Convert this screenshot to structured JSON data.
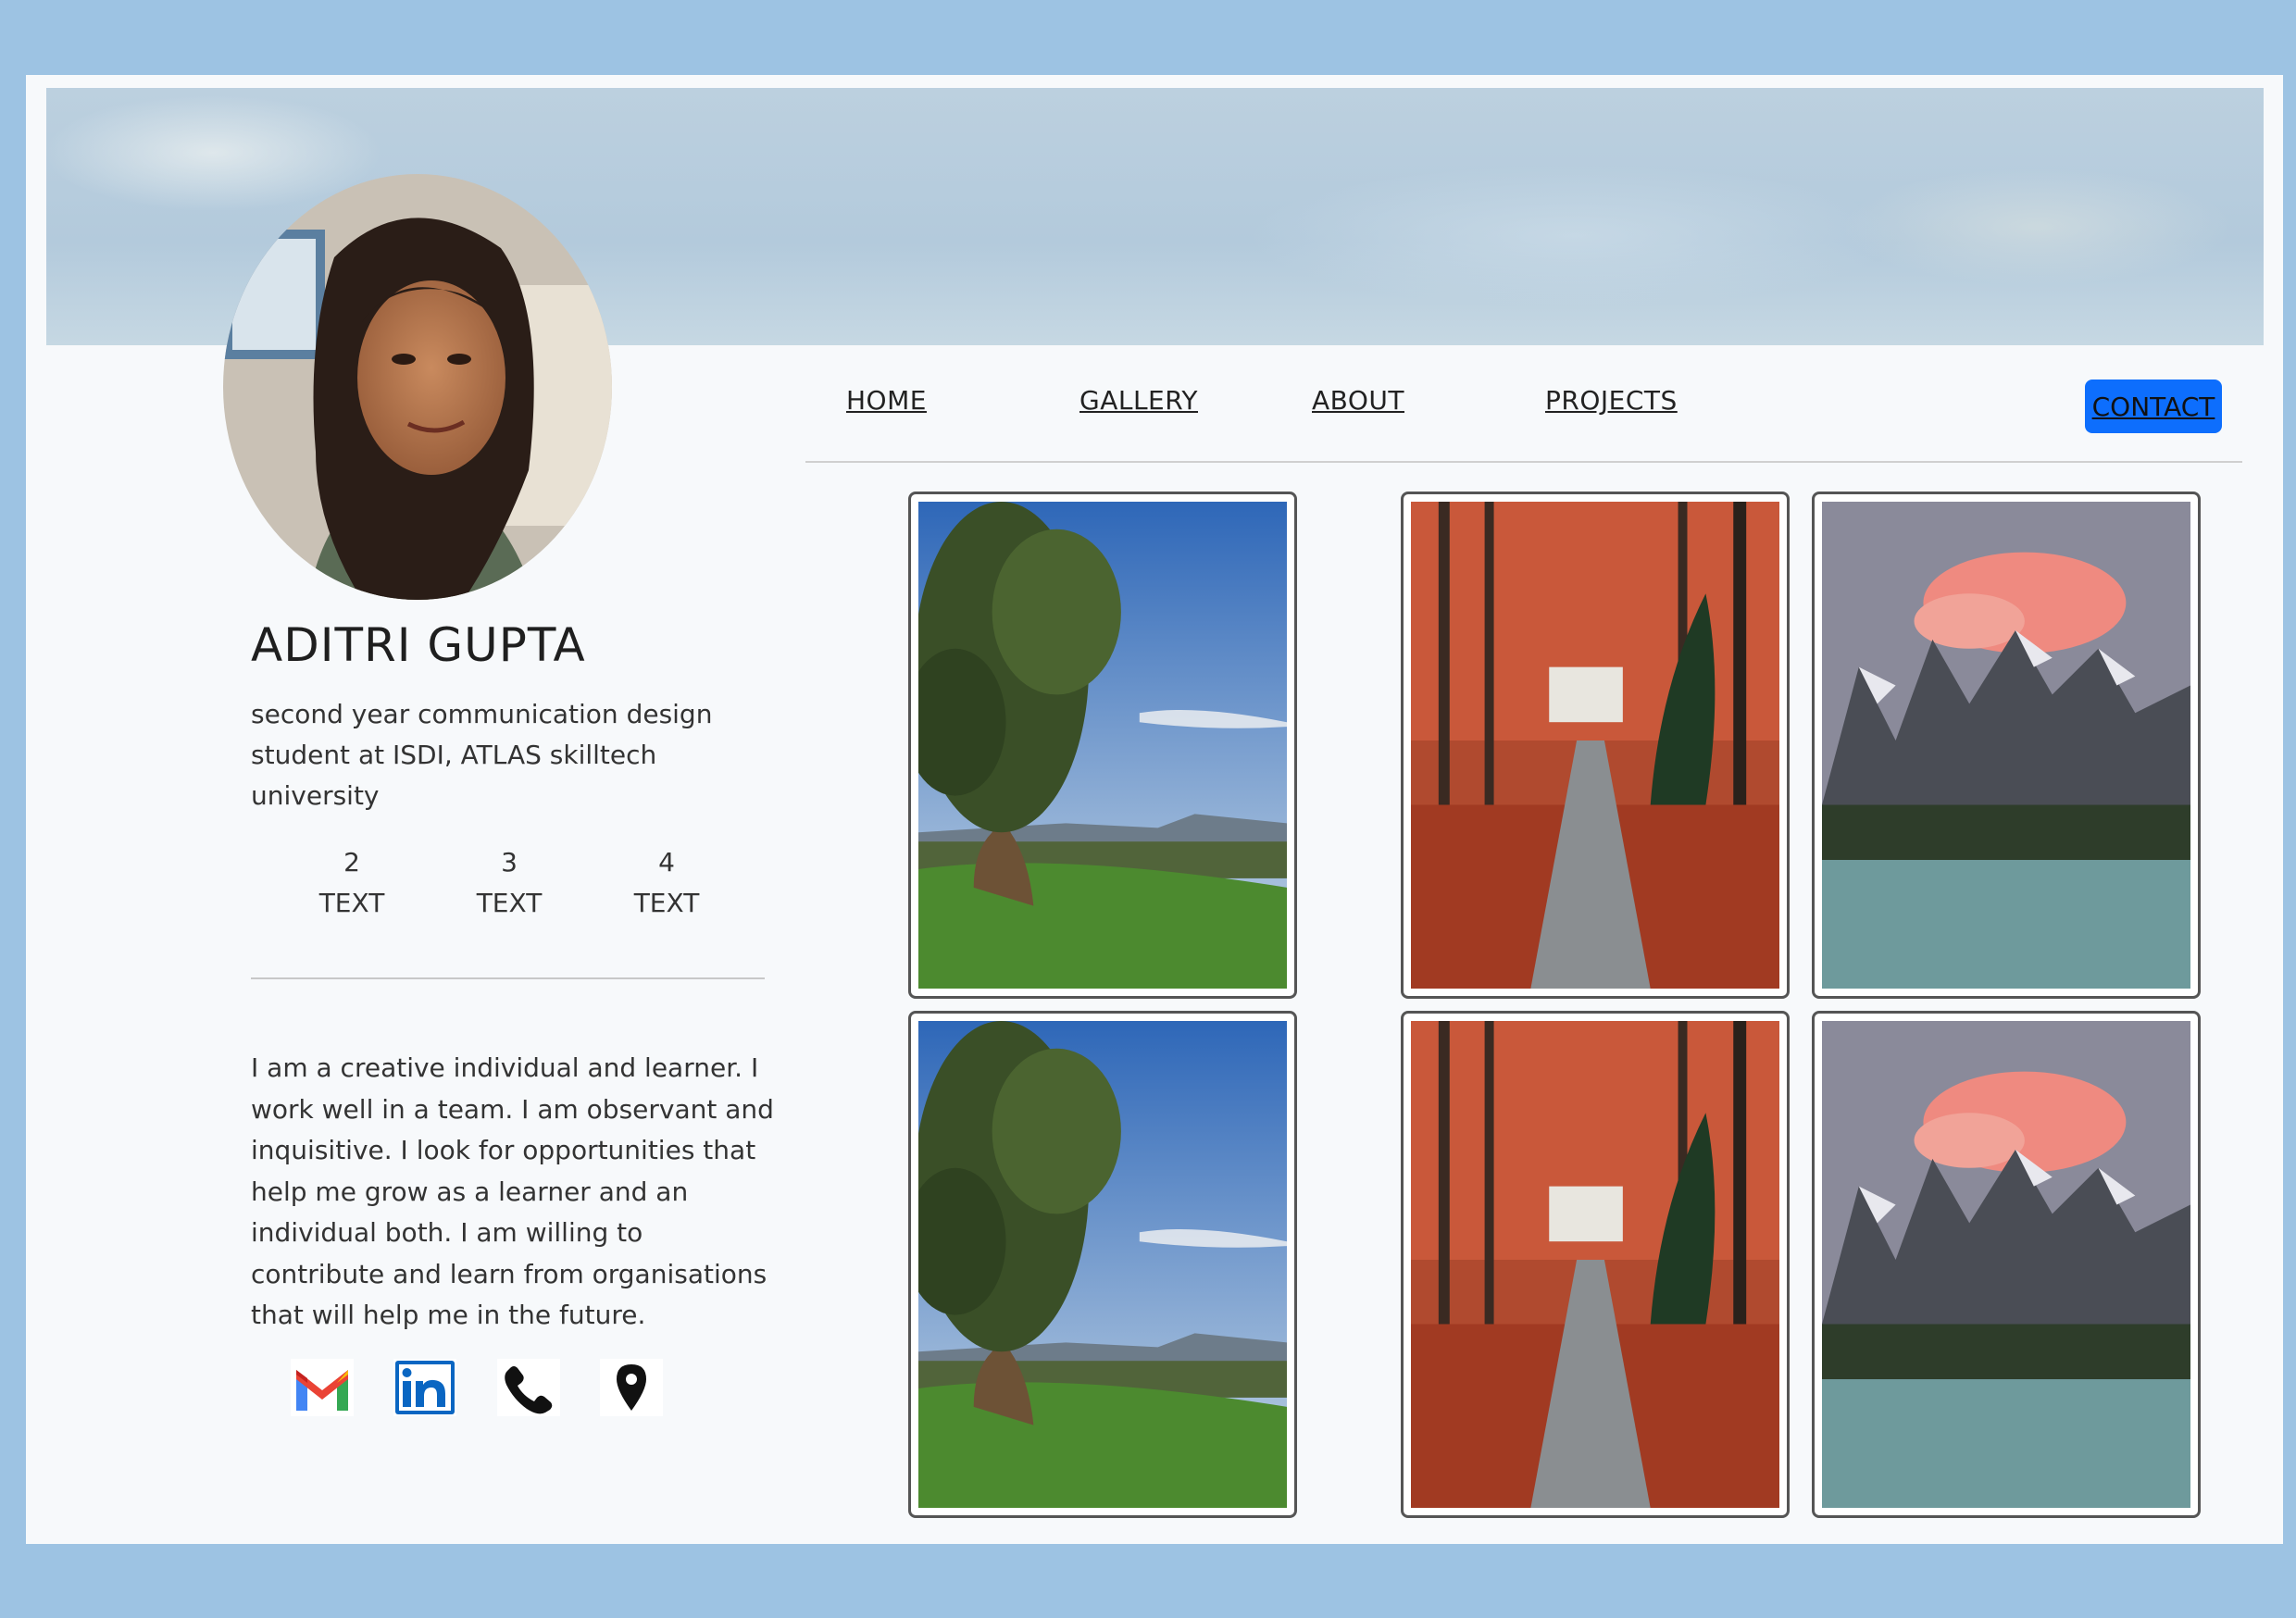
{
  "profile": {
    "name": "ADITRI GUPTA",
    "subtitle": "second year communication design student at ISDI, ATLAS skilltech university",
    "stats": [
      {
        "value": "2",
        "label": "TEXT"
      },
      {
        "value": "3",
        "label": "TEXT"
      },
      {
        "value": "4",
        "label": "TEXT"
      }
    ],
    "bio": "I am a creative individual and learner. I work well in a team. I am observant and inquisitive. I look for opportunities that help me grow as a learner and an individual both. I am willing to contribute and learn from organisations that will help me in the future."
  },
  "nav": {
    "home": "HOME",
    "gallery": "GALLERY",
    "about": "ABOUT",
    "projects": "PROJECTS",
    "contact": "CONTACT"
  },
  "social": [
    "gmail-icon",
    "linkedin-icon",
    "phone-icon",
    "location-pin-icon"
  ],
  "gallery": [
    {
      "image": "tree-landscape"
    },
    {
      "image": "autumn-path"
    },
    {
      "image": "mountain-lake"
    },
    {
      "image": "tree-landscape"
    },
    {
      "image": "autumn-path"
    },
    {
      "image": "mountain-lake"
    }
  ],
  "colors": {
    "page_bg": "#9dc3e3",
    "card_bg": "#f7f9fb",
    "contact_button": "#0d6efd"
  }
}
